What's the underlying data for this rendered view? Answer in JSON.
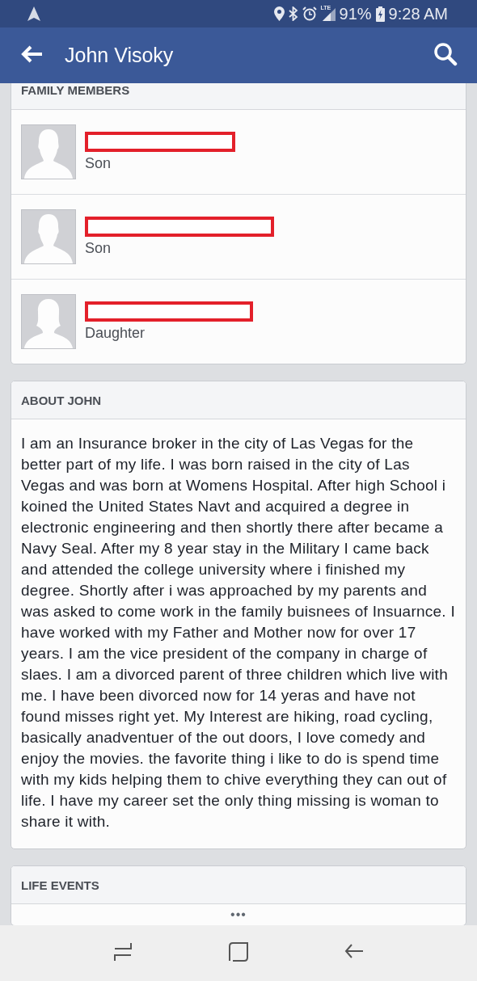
{
  "status_bar": {
    "network": "LTE",
    "battery": "91%",
    "time": "9:28 AM"
  },
  "app_bar": {
    "title": "John Visoky"
  },
  "family_members": {
    "title": "FAMILY MEMBERS",
    "members": [
      {
        "relation": "Son",
        "redacted": true
      },
      {
        "relation": "Son",
        "redacted": true
      },
      {
        "relation": "Daughter",
        "redacted": true
      }
    ]
  },
  "about": {
    "title": "ABOUT JOHN",
    "text": "I am an Insurance broker in the city of Las Vegas for the better part of my life. I was born raised in the city of Las Vegas and was born at Womens Hospital. After high School i koined the United States Navt and acquired a degree in electronic engineering and then shortly there after became a Navy Seal. After my 8 year stay in the Military I came back and attended the college university where i finished my degree. Shortly after i was approached by my parents and was asked to come work in the family buisnees of Insuarnce. I have worked with my Father and Mother now for over 17 years. I am the vice president of the company in charge of slaes. I am a divorced parent of three children which live with me. I have been divorced now for 14 yeras and have not found misses right yet. My Interest are hiking, road cycling, basically anadventuer of the out doors, I love comedy and enjoy the movies. the favorite thing i like to do is spend time with my kids helping them to chive everything they can out of life. I have my career set the only thing missing is woman to share it with."
  },
  "life_events": {
    "title": "LIFE EVENTS",
    "more": "•••"
  }
}
